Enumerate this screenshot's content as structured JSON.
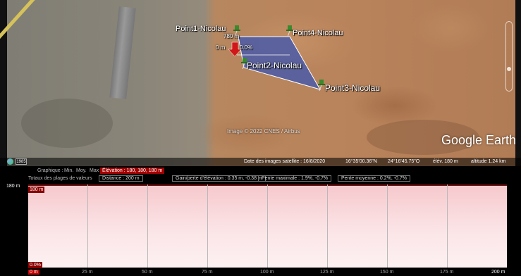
{
  "map": {
    "placemarks": [
      {
        "label": "Point1-Nicolau",
        "color": "green"
      },
      {
        "label": "Point4-Nicolau",
        "color": "green"
      },
      {
        "label": "Point2-Nicolau",
        "color": "green"
      },
      {
        "label": "Point3-Nicolau",
        "color": "green"
      }
    ],
    "marker_labels": {
      "top": "780 m",
      "left": "0 m",
      "pct": "0.0%"
    },
    "polygon_color": "#4a5aa8",
    "imagery_credit": "Image © 2022 CNES / Airbus",
    "watermark": "Google Earth",
    "history_badge": "1985",
    "status": {
      "imagery_date": "Date des images satellite : 16/8/2020",
      "lat": "16°35'00.36\"N",
      "lon": "24°16'45.75\"O",
      "elev": "élév. 180 m",
      "altitude": "altitude  1.24 km"
    }
  },
  "profile": {
    "legend": {
      "graph_label": "Graphique :",
      "min_label": "Min.",
      "avg_label": "Moy.",
      "max_label": "Max",
      "elevation": "Élévation : 180, 180, 180 m",
      "range_totals": "Totaux des plages de valeurs",
      "distance": "Distance : 200 m",
      "gain_loss": "Gain/perte d'élévation : 0.35 m, -0.38 m",
      "max_slope": "Pente maximale : 1.9%, -0.7%",
      "avg_slope": "Pente moyenne : 0.2%, -0.7%"
    },
    "y_axis_label": "180 m",
    "y_marker_top": "180 m",
    "y_marker_bottom": "0.0%",
    "x_ticks": [
      "0 m",
      "25 m",
      "50 m",
      "75 m",
      "100 m",
      "125 m",
      "150 m",
      "175 m",
      "200 m"
    ],
    "fill_color": "#f6c8cc"
  }
}
